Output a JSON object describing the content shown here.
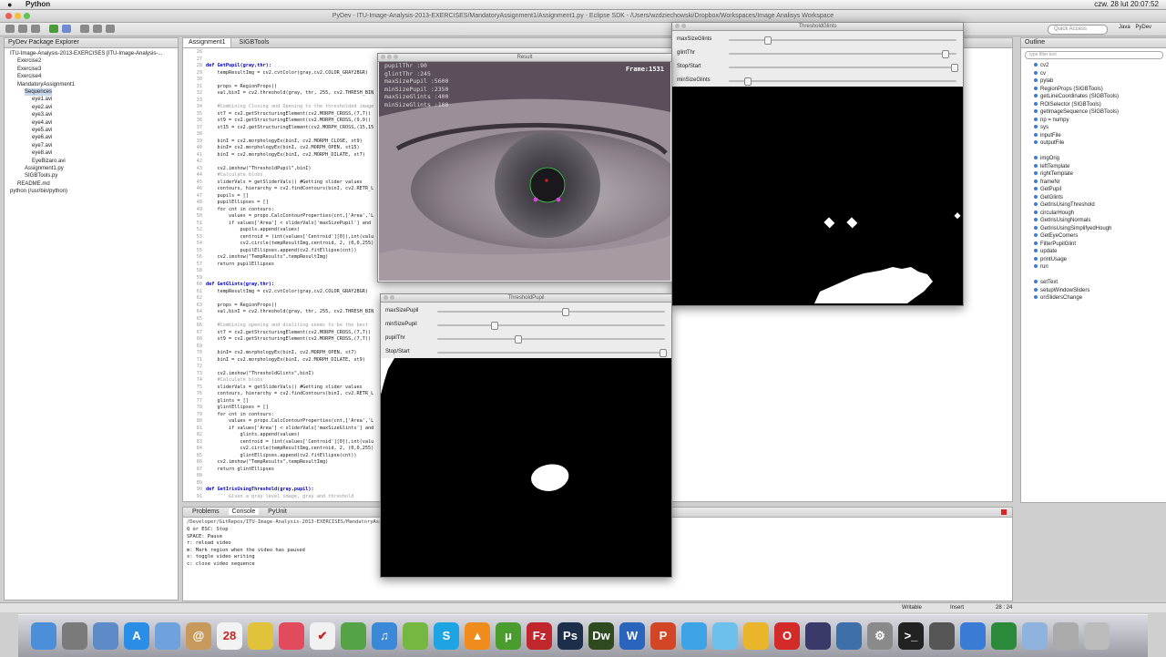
{
  "menubar": {
    "apple": "",
    "app": "Python",
    "right": "czw. 28 lut  20:07:52"
  },
  "window": {
    "title": "PyDev - ITU-Image-Analysis-2013-EXERCISES/MandatoryAssignment1/Assignment1.py - Eclipse SDK - /Users/wzdziechowski/Dropbox/Workspaces/Image Analisys Workspace"
  },
  "toolbar": {
    "quick_access": "Quick Access",
    "perspectives": [
      "Java",
      "PyDev"
    ]
  },
  "package_explorer": {
    "title": "PyDev Package Explorer",
    "items": [
      {
        "label": "ITU-Image-Analysis-2013-EXERCISES [ITU-Image-Analysis-...",
        "indent": 0
      },
      {
        "label": "Exercise2",
        "indent": 1
      },
      {
        "label": "Exercise3",
        "indent": 1
      },
      {
        "label": "Exercise4",
        "indent": 1
      },
      {
        "label": "MandatoryAssignment1",
        "indent": 1
      },
      {
        "label": "Sequences",
        "indent": 2
      },
      {
        "label": "eye1.avi",
        "indent": 3
      },
      {
        "label": "eye2.avi",
        "indent": 3
      },
      {
        "label": "eye3.avi",
        "indent": 3
      },
      {
        "label": "eye4.avi",
        "indent": 3
      },
      {
        "label": "eye5.avi",
        "indent": 3
      },
      {
        "label": "eye6.avi",
        "indent": 3
      },
      {
        "label": "eye7.avi",
        "indent": 3
      },
      {
        "label": "eye8.avi",
        "indent": 3
      },
      {
        "label": "EyeBizaro.avi",
        "indent": 3
      },
      {
        "label": "Assignment1.py",
        "indent": 2
      },
      {
        "label": "SIGBTools.py",
        "indent": 2
      },
      {
        "label": "README.md",
        "indent": 1
      },
      {
        "label": "python  (/usr/bin/python)",
        "indent": 0
      }
    ]
  },
  "editor": {
    "tabs": [
      "Assignment1",
      "SIGBTools"
    ],
    "lines": [
      {
        "n": "26",
        "t": ""
      },
      {
        "n": "27",
        "t": ""
      },
      {
        "n": "28",
        "t": "def GetPupil(gray,thr):"
      },
      {
        "n": "29",
        "t": "    tempResultImg = cv2.cvtColor(gray,cv2.COLOR_GRAY2BGR)"
      },
      {
        "n": "30",
        "t": ""
      },
      {
        "n": "31",
        "t": "    props = RegionProps()"
      },
      {
        "n": "32",
        "t": "    val,binI = cv2.threshold(gray, thr, 255, cv2.THRESH_BINARY_INV)"
      },
      {
        "n": "33",
        "t": ""
      },
      {
        "n": "34",
        "t": "    #Combining Closing and Opening to the thresholded image"
      },
      {
        "n": "35",
        "t": "    st7 = cv2.getStructuringElement(cv2.MORPH_CROSS,(7,7))"
      },
      {
        "n": "36",
        "t": "    st9 = cv2.getStructuringElement(cv2.MORPH_CROSS,(9,9))"
      },
      {
        "n": "37",
        "t": "    st15 = cv2.getStructuringElement(cv2.MORPH_CROSS,(15,15))"
      },
      {
        "n": "38",
        "t": ""
      },
      {
        "n": "39",
        "t": "    binI = cv2.morphologyEx(binI, cv2.MORPH_CLOSE, st9)"
      },
      {
        "n": "40",
        "t": "    binI= cv2.morphologyEx(binI, cv2.MORPH_OPEN, st15)"
      },
      {
        "n": "41",
        "t": "    binI = cv2.morphologyEx(binI, cv2.MORPH_DILATE, st7)"
      },
      {
        "n": "42",
        "t": ""
      },
      {
        "n": "43",
        "t": "    cv2.imshow(\"ThresholdPupil\",binI)"
      },
      {
        "n": "44",
        "t": "    #Calculate blobs"
      },
      {
        "n": "45",
        "t": "    sliderVals = getSliderVals() #Getting slider values"
      },
      {
        "n": "46",
        "t": "    contours, hierarchy = cv2.findContours(binI, cv2.RETR_LIST, cv2.CHAIN_APPROX_SIMPLE)"
      },
      {
        "n": "47",
        "t": "    pupils = []"
      },
      {
        "n": "48",
        "t": "    pupilEllipses = []"
      },
      {
        "n": "49",
        "t": "    for cnt in contours:"
      },
      {
        "n": "50",
        "t": "        values = props.CalcContourProperties(cnt,['Area','Length','Centroid'])"
      },
      {
        "n": "51",
        "t": "        if values['Area'] < sliderVals['maxSizePupil'] and values['Area'] > 100:"
      },
      {
        "n": "52",
        "t": "            pupils.append(values)"
      },
      {
        "n": "53",
        "t": "            centroid = (int(values['Centroid'][0]),int(values['Centroid'][1]))"
      },
      {
        "n": "54",
        "t": "            cv2.circle(tempResultImg,centroid, 2, (0,0,255),4)"
      },
      {
        "n": "55",
        "t": "            pupilEllipses.append(cv2.fitEllipse(cnt))"
      },
      {
        "n": "56",
        "t": "    cv2.imshow(\"TempResults\",tempResultImg)"
      },
      {
        "n": "57",
        "t": "    return pupilEllipses"
      },
      {
        "n": "58",
        "t": ""
      },
      {
        "n": "59",
        "t": ""
      },
      {
        "n": "60",
        "t": "def GetGlints(gray,thr):"
      },
      {
        "n": "61",
        "t": "    tempResultImg = cv2.cvtColor(gray,cv2.COLOR_GRAY2BGR)"
      },
      {
        "n": "62",
        "t": ""
      },
      {
        "n": "63",
        "t": "    props = RegionProps()"
      },
      {
        "n": "64",
        "t": "    val,binI = cv2.threshold(gray, thr, 255, cv2.THRESH_BINARY)"
      },
      {
        "n": "65",
        "t": ""
      },
      {
        "n": "66",
        "t": "    #Combining opening and dialiting seems to be the best"
      },
      {
        "n": "67",
        "t": "    st7 = cv2.getStructuringElement(cv2.MORPH_CROSS,(7,7))"
      },
      {
        "n": "68",
        "t": "    st9 = cv2.getStructuringElement(cv2.MORPH_CROSS,(7,7))"
      },
      {
        "n": "69",
        "t": ""
      },
      {
        "n": "70",
        "t": "    binI= cv2.morphologyEx(binI, cv2.MORPH_OPEN, st7)"
      },
      {
        "n": "71",
        "t": "    binI = cv2.morphologyEx(binI, cv2.MORPH_DILATE, st9)"
      },
      {
        "n": "72",
        "t": ""
      },
      {
        "n": "73",
        "t": "    cv2.imshow(\"ThresholdGlints\",binI)"
      },
      {
        "n": "74",
        "t": "    #Calculate blobs"
      },
      {
        "n": "75",
        "t": "    sliderVals = getSliderVals() #Getting slider values"
      },
      {
        "n": "76",
        "t": "    contours, hierarchy = cv2.findContours(binI, cv2.RETR_LIST, cv2.CHAIN_APPROX_SIMPLE)"
      },
      {
        "n": "77",
        "t": "    glints = []"
      },
      {
        "n": "78",
        "t": "    glintEllipses = []"
      },
      {
        "n": "79",
        "t": "    for cnt in contours:"
      },
      {
        "n": "80",
        "t": "        values = props.CalcContourProperties(cnt,['Area','Length','Centroid'])"
      },
      {
        "n": "81",
        "t": "        if values['Area'] < sliderVals['maxSizeGlints'] and values['Area'] > 10:"
      },
      {
        "n": "82",
        "t": "            glints.append(values)"
      },
      {
        "n": "83",
        "t": "            centroid = (int(values['Centroid'][0]),int(values['Centroid'][1]))"
      },
      {
        "n": "84",
        "t": "            cv2.circle(tempResultImg,centroid, 2, (0,0,255),4)"
      },
      {
        "n": "85",
        "t": "            glintEllipses.append(cv2.fitEllipse(cnt))"
      },
      {
        "n": "86",
        "t": "    cv2.imshow(\"TempResults\",tempResultImg)"
      },
      {
        "n": "87",
        "t": "    return glintEllipses"
      },
      {
        "n": "88",
        "t": ""
      },
      {
        "n": "89",
        "t": ""
      },
      {
        "n": "90",
        "t": "def GetIrisUsingThreshold(gray,pupil):"
      },
      {
        "n": "91",
        "t": "    ''' Given a gray level image, gray and threshold"
      }
    ]
  },
  "result_window": {
    "title": "Result",
    "overlay": [
      "pupilThr :90",
      "glintThr :245",
      "maxSizePupil :5600",
      "minSizePupil :2350",
      "maxSizeGlints :400",
      "minSizeGlints :100"
    ],
    "frame": "Frame:1531"
  },
  "threshold_glints": {
    "title": "ThresholdGlints",
    "sliders": [
      {
        "label": "maxSizeGlints",
        "fraction": 0.16
      },
      {
        "label": "glintThr",
        "fraction": 0.96
      },
      {
        "label": "Stop/Start",
        "fraction": 1.0
      },
      {
        "label": "minSizeGlints",
        "fraction": 0.07
      }
    ]
  },
  "threshold_pupil": {
    "title": "ThresholdPupil",
    "sliders": [
      {
        "label": "maxSizePupil",
        "fraction": 0.56
      },
      {
        "label": "minSizePupil",
        "fraction": 0.24
      },
      {
        "label": "pupilThr",
        "fraction": 0.35
      },
      {
        "label": "Stop/Start",
        "fraction": 1.0
      }
    ]
  },
  "outline": {
    "title": "Outline",
    "filter_placeholder": "type filter text",
    "items": [
      "cv2",
      "cv",
      "pylab",
      "RegionProps (SIGBTools)",
      "getLineCoordinates (SIGBTools)",
      "ROISelector (SIGBTools)",
      "getImageSequence (SIGBTools)",
      "np = numpy",
      "sys",
      "inputFile",
      "outputFile",
      "",
      "imgOrig",
      "leftTemplate",
      "rightTemplate",
      "frameNr",
      "GetPupil",
      "GetGlints",
      "GetIrisUsingThreshold",
      "circularHough",
      "GetIrisUsingNormals",
      "GetIrisUsingSimplifyedHough",
      "GetEyeCorners",
      "FilterPupilGlint",
      "update",
      "printUsage",
      "run",
      "",
      "setText",
      "setupWindowSliders",
      "onSlidersChange"
    ]
  },
  "console": {
    "tabs": [
      "Problems",
      "Console",
      "PyUnit"
    ],
    "path": "/Developer/GitRepos/ITU-Image-Analysis-2013-EXERCISES/MandatoryAssignment1/Assignment1.py",
    "lines": [
      "Q or ESC: Stop",
      "SPACE: Pause",
      "r: reload video",
      "m: Mark region when the video has paused",
      "s: toggle video  writing",
      "c: close video sequence"
    ]
  },
  "status": {
    "writable": "Writable",
    "insert": "Insert",
    "position": "28 : 24"
  },
  "dock": {
    "apps": [
      {
        "name": "finder",
        "color": "#4a8fd8",
        "glyph": ""
      },
      {
        "name": "launchpad",
        "color": "#7a7a7a",
        "glyph": ""
      },
      {
        "name": "preview",
        "color": "#5d8bc7",
        "glyph": ""
      },
      {
        "name": "app-store",
        "color": "#2b8ee6",
        "glyph": "A"
      },
      {
        "name": "mail",
        "color": "#6fa2dc",
        "glyph": ""
      },
      {
        "name": "contacts",
        "color": "#c79a5c",
        "glyph": "@"
      },
      {
        "name": "calendar",
        "color": "#f3f3f3",
        "glyph": "28"
      },
      {
        "name": "notes",
        "color": "#e0c33a",
        "glyph": ""
      },
      {
        "name": "pocket",
        "color": "#e24b5b",
        "glyph": ""
      },
      {
        "name": "reminders",
        "color": "#f1f1f1",
        "glyph": "✔"
      },
      {
        "name": "evernote",
        "color": "#55a247",
        "glyph": ""
      },
      {
        "name": "itunes",
        "color": "#3b88d9",
        "glyph": "♫"
      },
      {
        "name": "spotify",
        "color": "#74b841",
        "glyph": ""
      },
      {
        "name": "skype",
        "color": "#1ea4e2",
        "glyph": "S"
      },
      {
        "name": "vlc",
        "color": "#f08c1c",
        "glyph": "▲"
      },
      {
        "name": "utorrent",
        "color": "#4a9c2f",
        "glyph": "μ"
      },
      {
        "name": "filezilla",
        "color": "#c0272d",
        "glyph": "Fz"
      },
      {
        "name": "photoshop",
        "color": "#1d2e4b",
        "glyph": "Ps"
      },
      {
        "name": "dreamweaver",
        "color": "#2f4a1f",
        "glyph": "Dw"
      },
      {
        "name": "word",
        "color": "#2a64bd",
        "glyph": "W"
      },
      {
        "name": "powerpoint",
        "color": "#d24625",
        "glyph": "P"
      },
      {
        "name": "twitter",
        "color": "#3ca4e6",
        "glyph": ""
      },
      {
        "name": "messages",
        "color": "#6ec0ec",
        "glyph": ""
      },
      {
        "name": "chrome",
        "color": "#e8b52b",
        "glyph": ""
      },
      {
        "name": "opera",
        "color": "#d32a2a",
        "glyph": "O"
      },
      {
        "name": "eclipse",
        "color": "#3a3a6a",
        "glyph": ""
      },
      {
        "name": "virtualbox",
        "color": "#3f6fa8",
        "glyph": ""
      },
      {
        "name": "system-preferences",
        "color": "#8a8a8a",
        "glyph": "⚙"
      },
      {
        "name": "terminal",
        "color": "#222222",
        "glyph": ">_"
      },
      {
        "name": "activity-monitor",
        "color": "#555555",
        "glyph": ""
      },
      {
        "name": "network",
        "color": "#3a7bd5",
        "glyph": ""
      },
      {
        "name": "excel",
        "color": "#2a8a3a",
        "glyph": ""
      },
      {
        "name": "folder",
        "color": "#8fb3dd",
        "glyph": ""
      },
      {
        "name": "disk",
        "color": "#aaaaaa",
        "glyph": ""
      },
      {
        "name": "trash",
        "color": "#bcbcbc",
        "glyph": ""
      }
    ]
  }
}
